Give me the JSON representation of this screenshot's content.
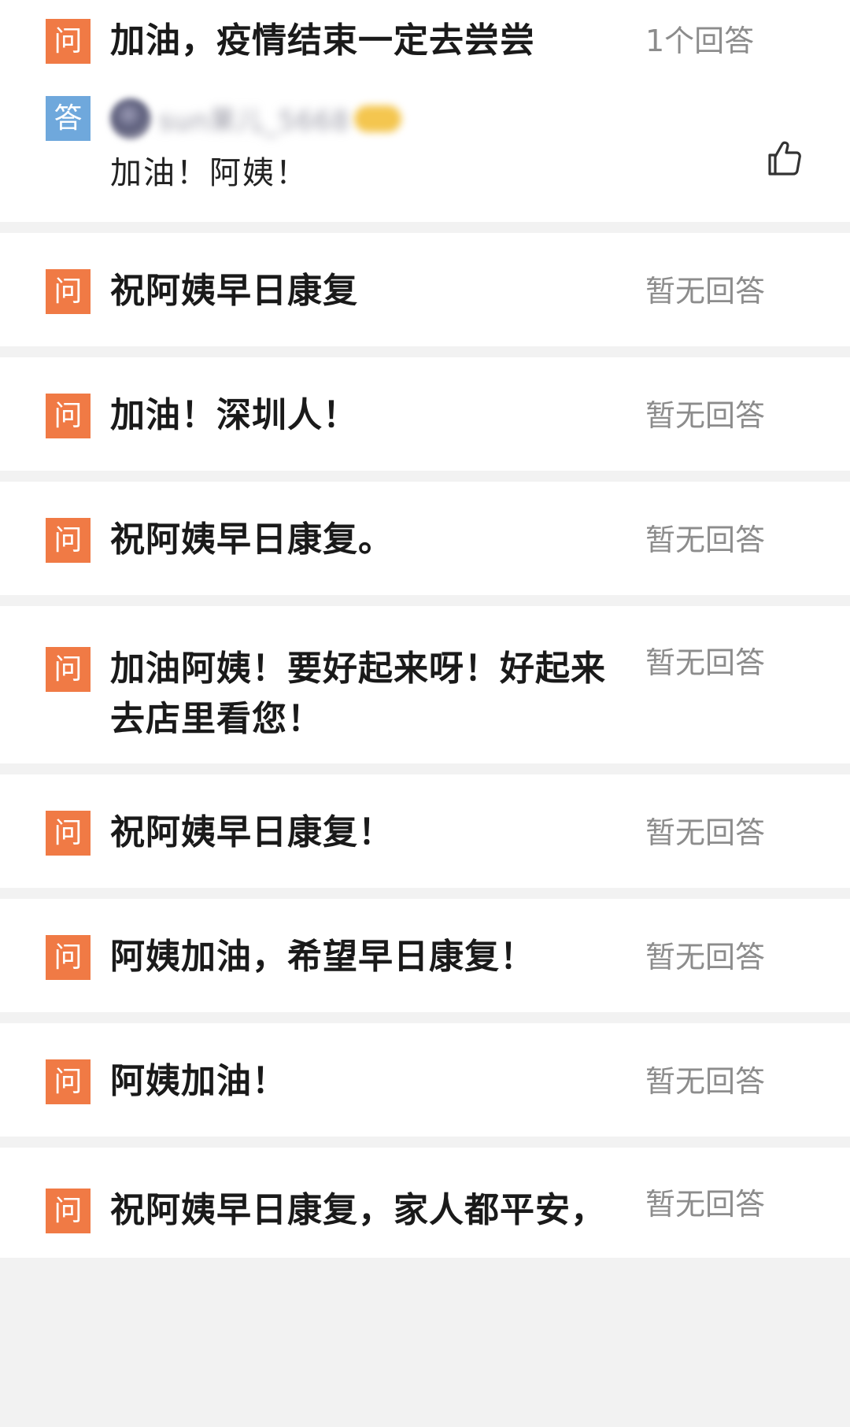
{
  "badges": {
    "question": "问",
    "answer": "答"
  },
  "questions": [
    {
      "text": "加油，疫情结束一定去尝尝",
      "count": "1个回答",
      "answer": {
        "author_name": "sun果儿_5668",
        "author_level": "Lv1",
        "text": "加油！阿姨！"
      }
    },
    {
      "text": "祝阿姨早日康复",
      "count": "暂无回答"
    },
    {
      "text": "加油！深圳人！",
      "count": "暂无回答"
    },
    {
      "text": "祝阿姨早日康复。",
      "count": "暂无回答"
    },
    {
      "text": "加油阿姨！要好起来呀！好起来去店里看您！",
      "count": "暂无回答"
    },
    {
      "text": "祝阿姨早日康复！",
      "count": "暂无回答"
    },
    {
      "text": "阿姨加油，希望早日康复！",
      "count": "暂无回答"
    },
    {
      "text": "阿姨加油！",
      "count": "暂无回答"
    },
    {
      "text": "祝阿姨早日康复，家人都平安，",
      "count": "暂无回答"
    }
  ],
  "icons": {
    "like": "thumbs-up-icon"
  },
  "colors": {
    "question_badge": "#f07a45",
    "answer_badge": "#6fa8dc",
    "muted_text": "#8c8c8c",
    "separator": "#f2f2f2"
  }
}
